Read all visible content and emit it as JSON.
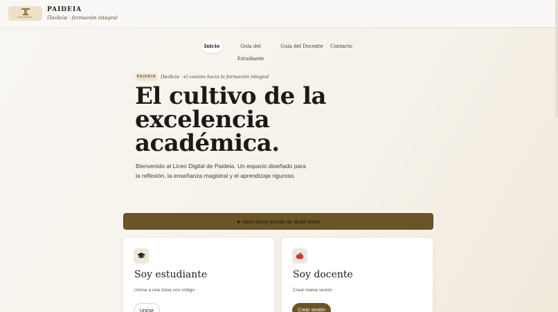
{
  "header": {
    "logo_word": "PAIDEIA",
    "brand_title": "PAIDEIA",
    "brand_subtitle": "Παιδεία · formación integral"
  },
  "nav": {
    "items": [
      {
        "label": "Inicio",
        "active": true
      },
      {
        "label": "Guía del Estudiante",
        "active": false
      },
      {
        "label": "Guía del Docente",
        "active": false
      },
      {
        "label": "Contacto",
        "active": false
      }
    ]
  },
  "hero": {
    "badge": "PAIDEIA",
    "tagline": "Παιδεία · el camino hacia la formación integral",
    "title_lines": [
      "El cultivo de la",
      "excelencia",
      "académica."
    ],
    "description": "Bienvenido al Liceo Digital de Paideia. Un espacio diseñado para la reflexión, la enseñanza magistral y el aprendizaje riguroso."
  },
  "demo_button": {
    "label": "► Abrir demo guiado de Build Week"
  },
  "cards": [
    {
      "icon": "graduation-cap-icon",
      "title": "Soy estudiante",
      "subtitle": "Unirse a una clase con código",
      "button": "Unirse"
    },
    {
      "icon": "apple-icon",
      "title": "Soy docente",
      "subtitle": "Crear nueva sesión",
      "button": "Crear sesión"
    }
  ],
  "colors": {
    "accent": "#6b5528",
    "background": "#f6f2ea",
    "badge_bg": "#efe3cf",
    "text": "#1e1c18"
  }
}
